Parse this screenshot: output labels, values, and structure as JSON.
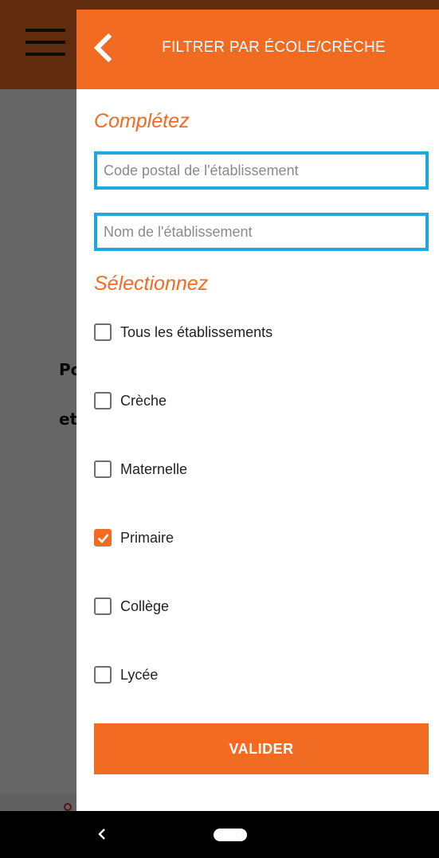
{
  "background": {
    "text_line_1": "Po",
    "text_line_2": "et"
  },
  "drawer": {
    "title": "FILTRER PAR ÉCOLE/CRÈCHE",
    "back_icon": "chevron-left-icon",
    "section_complete": "Complétez",
    "postal_code_placeholder": "Code postal de l'établissement",
    "postal_code_value": "",
    "name_placeholder": "Nom de l'établissement",
    "name_value": "",
    "section_select": "Sélectionnez",
    "options": [
      {
        "label": "Tous les établissements",
        "checked": false
      },
      {
        "label": "Crèche",
        "checked": false
      },
      {
        "label": "Maternelle",
        "checked": false
      },
      {
        "label": "Primaire",
        "checked": true
      },
      {
        "label": "Collège",
        "checked": false
      },
      {
        "label": "Lycée",
        "checked": false
      }
    ],
    "validate_label": "VALIDER"
  },
  "colors": {
    "accent": "#f26b23",
    "field_border": "#1ea8dc"
  },
  "nav": {
    "back_icon": "nav-back-icon",
    "home_icon": "nav-home-pill-icon"
  }
}
